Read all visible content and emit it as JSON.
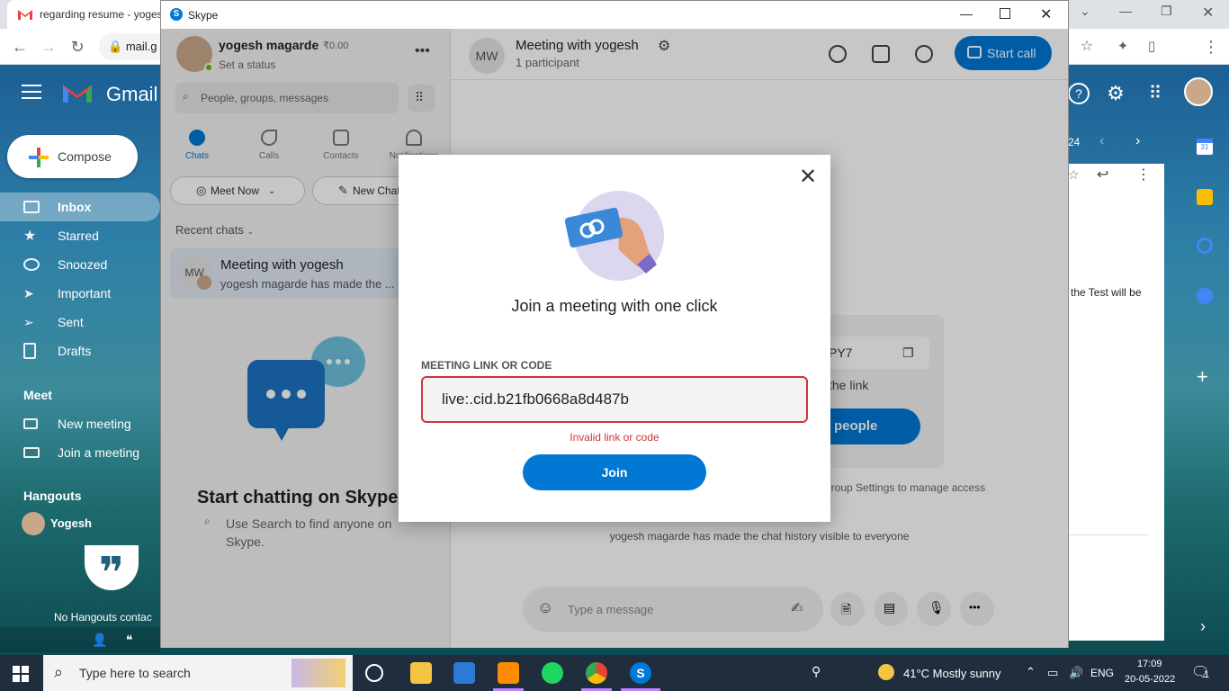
{
  "chrome": {
    "tab_title": "regarding resume - yoges",
    "url": "mail.g"
  },
  "gmail": {
    "brand": "Gmail",
    "compose": "Compose",
    "nav": [
      {
        "label": "Inbox",
        "icon": "inbox-icon"
      },
      {
        "label": "Starred",
        "icon": "star-icon"
      },
      {
        "label": "Snoozed",
        "icon": "clock-icon"
      },
      {
        "label": "Important",
        "icon": "important-icon"
      },
      {
        "label": "Sent",
        "icon": "send-icon"
      },
      {
        "label": "Drafts",
        "icon": "draft-icon"
      }
    ],
    "meet_heading": "Meet",
    "meet_items": [
      "New meeting",
      "Join a meeting"
    ],
    "hangouts_heading": "Hangouts",
    "hangouts_user": "Yogesh",
    "no_contacts": "No Hangouts contac",
    "date_fragment": "24",
    "mail_snippet": "the Test will be"
  },
  "skype": {
    "window_title": "Skype",
    "profile": {
      "name": "yogesh magarde",
      "credit": "₹0.00",
      "status": "Set a status"
    },
    "search_placeholder": "People, groups, messages",
    "tabs": [
      {
        "label": "Chats",
        "active": true
      },
      {
        "label": "Calls",
        "active": false
      },
      {
        "label": "Contacts",
        "active": false
      },
      {
        "label": "Notifications",
        "active": false
      }
    ],
    "meet_now": "Meet Now",
    "new_chat": "New Chat",
    "recent_chats_label": "Recent chats",
    "chat": {
      "initials": "MW",
      "title": "Meeting with yogesh",
      "preview": "yogesh magarde has made the ..."
    },
    "empty_title": "Start chatting on Skype",
    "empty_hint": "Use Search to find anyone on Skype.",
    "conversation": {
      "title": "Meeting with yogesh",
      "participants": "1 participant",
      "start_call": "Start call",
      "code_fragment": "PY7",
      "link_fragment": "the link",
      "invite_fragment": "people",
      "settings_note": "to Group Settings to manage access",
      "history_note": "yogesh magarde has made the chat history visible to everyone",
      "message_placeholder": "Type a message"
    }
  },
  "dialog": {
    "title": "Join a meeting with one click",
    "field_label": "MEETING LINK OR CODE",
    "field_value": "live:.cid.b21fb0668a8d487b",
    "error": "Invalid link or code",
    "join": "Join"
  },
  "taskbar": {
    "search_placeholder": "Type here to search",
    "weather": "41°C  Mostly sunny",
    "lang": "ENG",
    "time": "17:09",
    "date": "20-05-2022",
    "notifications": "1"
  },
  "colors": {
    "skype_blue": "#0078d4",
    "error_red": "#d13438"
  }
}
